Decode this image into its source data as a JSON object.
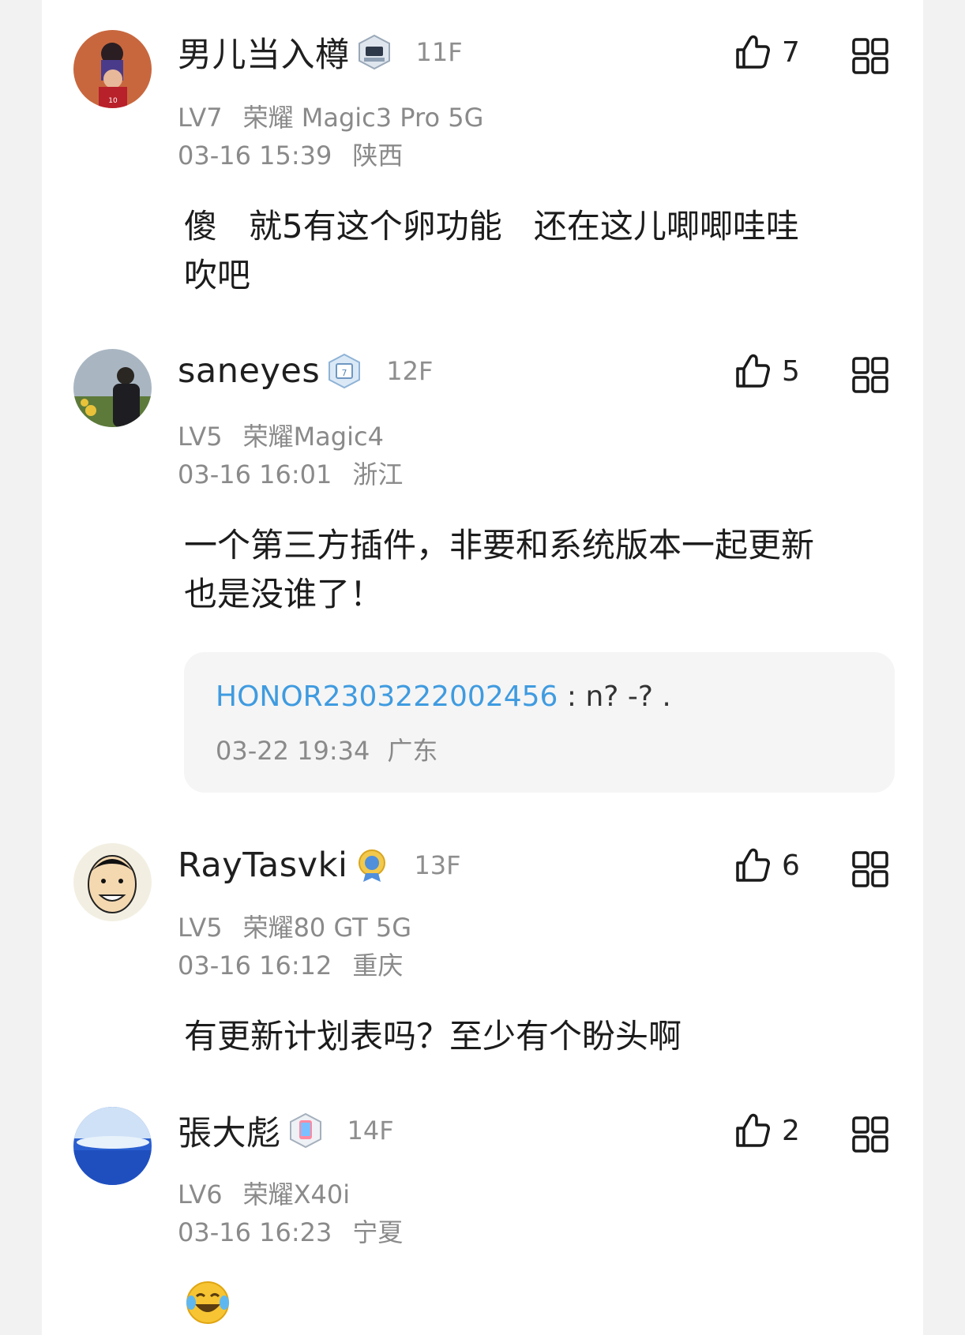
{
  "comments": [
    {
      "username": "男儿当入樽",
      "floor": "11F",
      "likes": "7",
      "level": "LV7",
      "device": "荣耀 Magic3 Pro 5G",
      "date": "03-16 15:39",
      "location": "陕西",
      "text": "傻   就5有这个卵功能   还在这儿唧唧哇哇\n吹吧",
      "badge_icon": "forum-badge-icon",
      "colors": {
        "avatar": "#c8673e"
      }
    },
    {
      "username": "saneyes",
      "floor": "12F",
      "likes": "5",
      "level": "LV5",
      "device": "荣耀Magic4",
      "date": "03-16 16:01",
      "location": "浙江",
      "text": "一个第三方插件，非要和系统版本一起更新\n也是没谁了！",
      "badge_icon": "calendar-badge-icon",
      "reply": {
        "username": "HONOR2303222002456",
        "text": " : n? -?   .",
        "date": "03-22 19:34",
        "location": "广东"
      }
    },
    {
      "username": "RayTasvki",
      "floor": "13F",
      "likes": "6",
      "level": "LV5",
      "device": "荣耀80 GT 5G",
      "date": "03-16 16:12",
      "location": "重庆",
      "text": "有更新计划表吗？至少有个盼头啊",
      "badge_icon": "medal-badge-icon"
    },
    {
      "username": "張大彪",
      "floor": "14F",
      "likes": "2",
      "level": "LV6",
      "device": "荣耀X40i",
      "date": "03-16 16:23",
      "location": "宁夏",
      "text": "",
      "badge_icon": "phone-badge-icon",
      "emoji": "tears-of-joy-emoji"
    }
  ],
  "colors": {
    "reply_user": "#3f9be0",
    "meta": "#8a8a8a",
    "reply_bg": "#f5f5f5"
  }
}
